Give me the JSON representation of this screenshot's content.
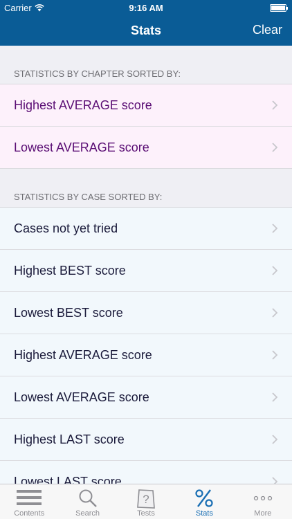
{
  "status": {
    "carrier": "Carrier",
    "time": "9:16 AM"
  },
  "nav": {
    "title": "Stats",
    "clear_label": "Clear"
  },
  "sections": {
    "chapter": {
      "header": "STATISTICS BY CHAPTER SORTED BY:",
      "items": [
        "Highest AVERAGE score",
        "Lowest AVERAGE score"
      ]
    },
    "case": {
      "header": "STATISTICS BY CASE SORTED BY:",
      "items": [
        "Cases not yet tried",
        "Highest BEST score",
        "Lowest BEST score",
        "Highest AVERAGE score",
        "Lowest AVERAGE score",
        "Highest LAST score",
        "Lowest LAST score"
      ]
    }
  },
  "tabs": [
    {
      "label": "Contents",
      "icon": "list-icon"
    },
    {
      "label": "Search",
      "icon": "magnifier-icon"
    },
    {
      "label": "Tests",
      "icon": "question-icon"
    },
    {
      "label": "Stats",
      "icon": "percent-icon"
    },
    {
      "label": "More",
      "icon": "ellipsis-icon"
    }
  ],
  "colors": {
    "nav_bg": "#0a5c96",
    "chapter_row_bg": "#fdf1fb",
    "case_row_bg": "#f2f8fc",
    "active_tab": "#1a6fb4"
  }
}
